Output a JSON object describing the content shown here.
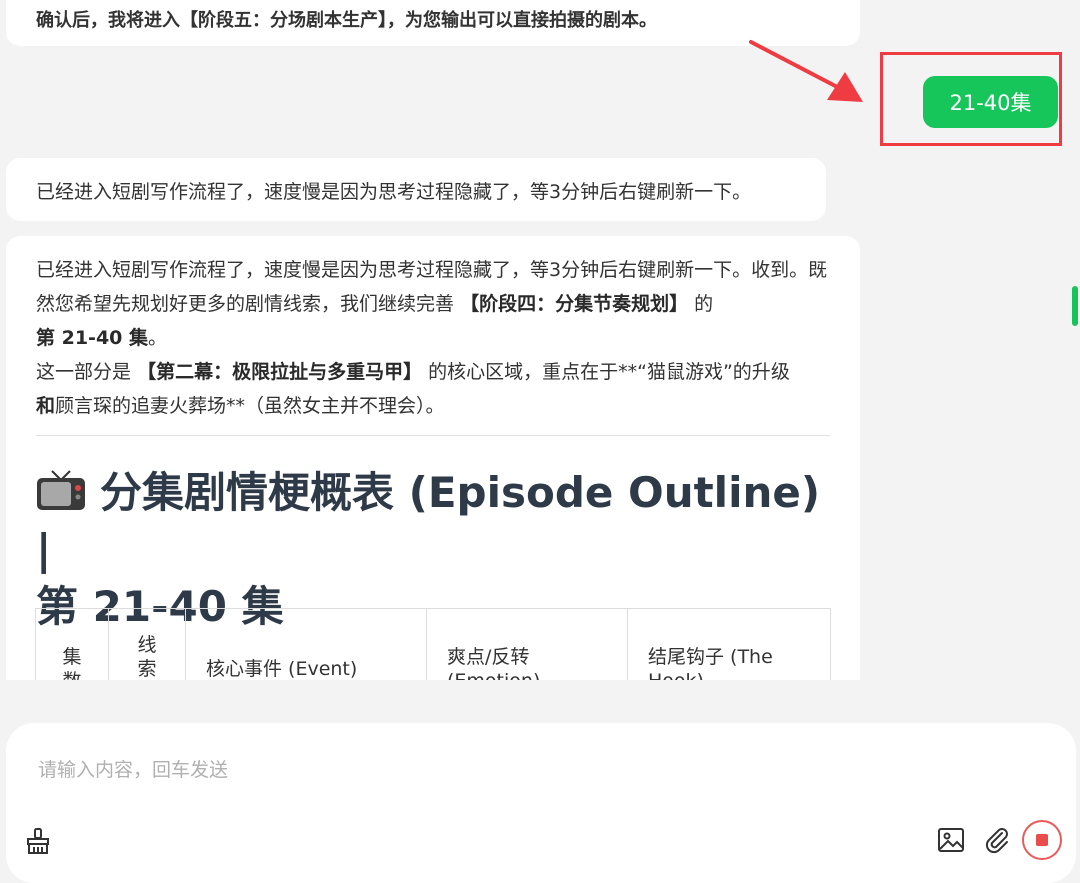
{
  "messages": {
    "top_partial": "确认后，我将进入【阶段五：分场剧本生产】，为您输出可以直接拍摄的剧本。",
    "user_reply": "21-40集",
    "assistant_short": "已经进入短剧写作流程了，速度慢是因为思考过程隐藏了，等3分钟后右键刷新一下。",
    "assistant_main": {
      "p1_a": "已经进入短剧写作流程了，速度慢是因为思考过程隐藏了，等3分钟后右键刷新一下。收到。既然您希望先规划好更多的剧情线索，我们继续完善",
      "p1_bold1": "【阶段四：分集节奏规划】",
      "p1_b": "的",
      "p1_bold2": "第 21-40 集",
      "p1_c": "。",
      "p2_a": "这一部分是",
      "p2_bold1": "【第二幕：极限拉扯与多重马甲】",
      "p2_b": "的核心区域，重点在于**“猫鼠游戏”的升级",
      "p2_bold2": "和",
      "p2_c": "顾言琛的追妻火葬场**（虽然女主并不理会）。",
      "heading_line1": "分集剧情梗概表 (Episode Outline) |",
      "heading_line2": "第 21-40 集",
      "table_headers": [
        "集数",
        "线索标",
        "核心事件 (Event)",
        "爽点/反转 (Emotion)",
        "结尾钩子 (The Hook)"
      ]
    }
  },
  "input": {
    "placeholder": "请输入内容，回车发送"
  },
  "icons": {
    "clear": "broom-icon",
    "image": "image-icon",
    "attach": "paperclip-icon",
    "stop": "stop-icon",
    "tv": "tv-emoji-icon"
  },
  "colors": {
    "user_bubble": "#16c65b",
    "highlight": "#ef3b42",
    "heading": "#2e3a48",
    "stop": "#ea4b4b"
  }
}
